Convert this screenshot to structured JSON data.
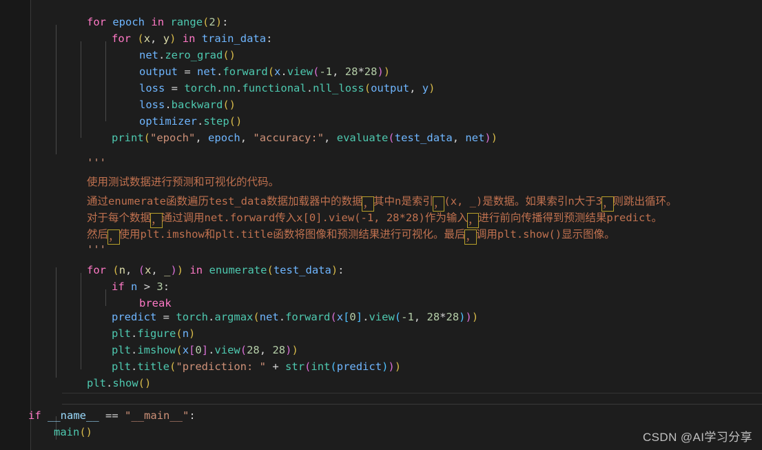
{
  "editor": {
    "theme": "dark",
    "background": "#1d1d1d",
    "gutter_background": "#181818",
    "accent_highlight_border": "#b8a02a"
  },
  "colors": {
    "keyword": "#ff79c6",
    "identifier": "#6fb6ff",
    "function": "#4ec9b0",
    "bracket_depth_1": "#d7ba4a",
    "bracket_depth_2": "#da70d6",
    "bracket_depth_3": "#4fc1ff",
    "number": "#b5cea8",
    "string": "#ce9178",
    "operator": "#d4d4d4",
    "chinese_comment": "#c0714f"
  },
  "code": {
    "top_docstring_marker": "'''",
    "lines": [
      {
        "id": "l01",
        "text": "    for epoch in range(2):"
      },
      {
        "id": "l02",
        "text": "        for (x, y) in train_data:"
      },
      {
        "id": "l03",
        "text": "            net.zero_grad()"
      },
      {
        "id": "l04",
        "text": "            output = net.forward(x.view(-1, 28*28))"
      },
      {
        "id": "l05",
        "text": "            loss = torch.nn.functional.nll_loss(output, y)"
      },
      {
        "id": "l06",
        "text": "            loss.backward()"
      },
      {
        "id": "l07",
        "text": "            optimizer.step()"
      },
      {
        "id": "l08",
        "text": "        print(\"epoch\", epoch, \"accuracy:\", evaluate(test_data, net))"
      },
      {
        "id": "l09",
        "text": ""
      },
      {
        "id": "l10",
        "text": "    '''"
      },
      {
        "id": "l11",
        "text": "    使用测试数据进行预测和可视化的代码。"
      },
      {
        "id": "l12",
        "text": "    通过enumerate函数遍历test_data数据加载器中的数据，其中n是索引，(x, _)是数据。如果索引n大于3，则跳出循环。"
      },
      {
        "id": "l13",
        "text": "    对于每个数据，通过调用net.forward传入x[0].view(-1, 28*28)作为输入，进行前向传播得到预测结果predict。"
      },
      {
        "id": "l14",
        "text": "    然后，使用plt.imshow和plt.title函数将图像和预测结果进行可视化。最后，调用plt.show()显示图像。"
      },
      {
        "id": "l15",
        "text": "    '''"
      },
      {
        "id": "l16",
        "text": "    for (n, (x, _)) in enumerate(test_data):"
      },
      {
        "id": "l17",
        "text": "        if n > 3:"
      },
      {
        "id": "l18",
        "text": "            break"
      },
      {
        "id": "l19",
        "text": "        predict = torch.argmax(net.forward(x[0].view(-1, 28*28)))"
      },
      {
        "id": "l20",
        "text": "        plt.figure(n)"
      },
      {
        "id": "l21",
        "text": "        plt.imshow(x[0].view(28, 28))"
      },
      {
        "id": "l22",
        "text": "        plt.title(\"prediction: \" + str(int(predict)))"
      },
      {
        "id": "l23",
        "text": "    plt.show()"
      },
      {
        "id": "l24",
        "text": ""
      },
      {
        "id": "l25",
        "text": "if __name__ == \"__main__\":"
      },
      {
        "id": "l26",
        "text": "    main()"
      }
    ]
  },
  "chinese_doc": {
    "line1": "使用测试数据进行预测和可视化的代码。",
    "line2_parts": [
      "通过enumerate函数遍历test_data数据加载器中的数据",
      "其中n是索引",
      "(x, _)是数据。如果索引n大于3",
      "则跳出循环。"
    ],
    "line3_parts": [
      "对于每个数据",
      "通过调用net.forward传入x[0].view(-1, 28*28)作为输入",
      "进行前向传播得到预测结果predict。"
    ],
    "line4_parts": [
      "然后",
      "使用plt.imshow和plt.title函数将图像和预测结果进行可视化。最后",
      "调用plt.show()显示图像。"
    ],
    "highlight_char": "，",
    "highlight_note": "full-width comma flagged by linter"
  },
  "watermark": {
    "text": "CSDN @AI学习分享"
  }
}
